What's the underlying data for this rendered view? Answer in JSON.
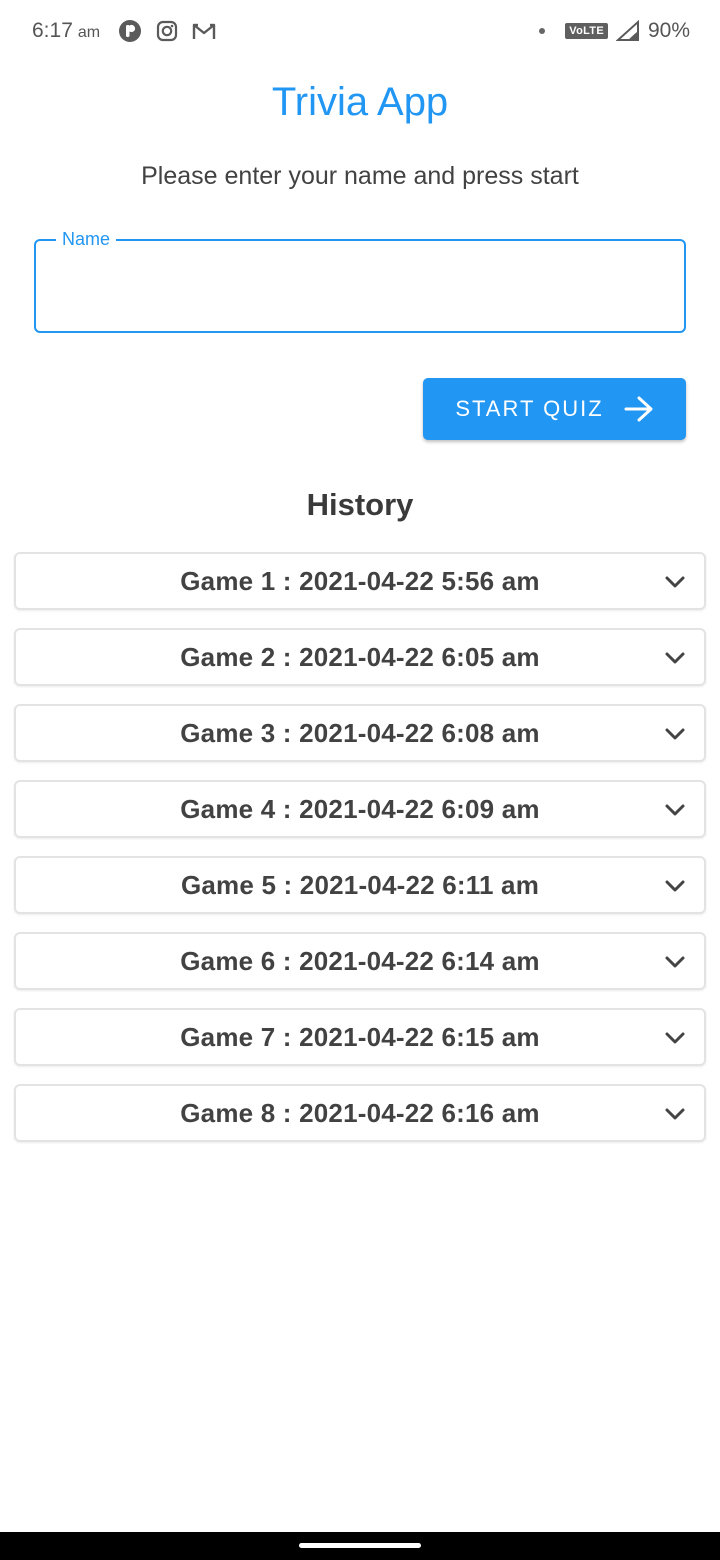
{
  "status_bar": {
    "time": "6:17",
    "ampm": "am",
    "notification_icons": [
      "podcast-icon",
      "instagram-icon",
      "gmail-icon"
    ],
    "network_badge": "VoLTE",
    "battery": "90%"
  },
  "header": {
    "title": "Trivia App",
    "subtitle": "Please enter your name and press start"
  },
  "name_field": {
    "label": "Name",
    "value": ""
  },
  "start_button": {
    "label": "START QUIZ",
    "icon": "arrow-right-icon"
  },
  "history": {
    "title": "History",
    "items": [
      {
        "label": "Game 1 : 2021-04-22 5:56 am"
      },
      {
        "label": "Game 2 : 2021-04-22 6:05 am"
      },
      {
        "label": "Game 3 : 2021-04-22 6:08 am"
      },
      {
        "label": "Game 4 : 2021-04-22 6:09 am"
      },
      {
        "label": "Game 5 : 2021-04-22 6:11 am"
      },
      {
        "label": "Game 6 : 2021-04-22 6:14 am"
      },
      {
        "label": "Game 7 : 2021-04-22 6:15 am"
      },
      {
        "label": "Game 8 : 2021-04-22 6:16 am"
      }
    ]
  },
  "colors": {
    "accent": "#2196f3",
    "text": "#424242",
    "border": "#e3e3e3"
  }
}
